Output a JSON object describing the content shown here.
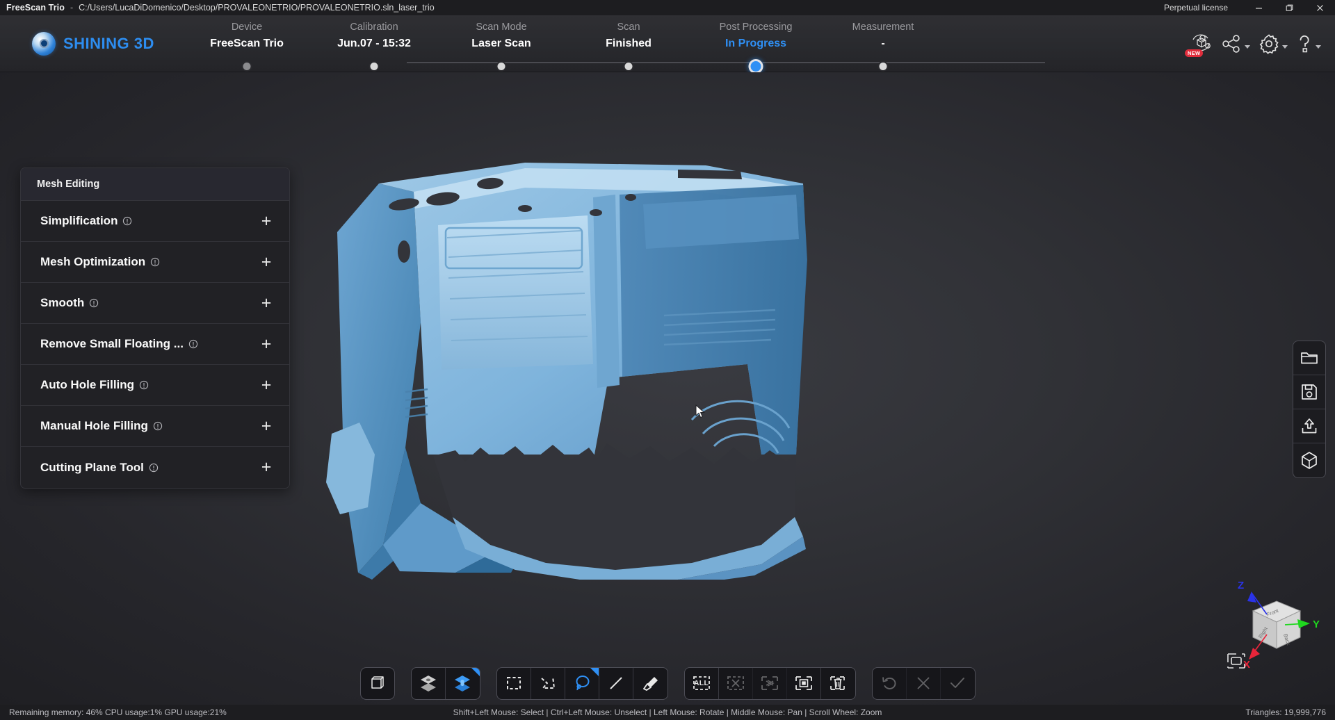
{
  "titlebar": {
    "app_name": "FreeScan Trio",
    "separator": "-",
    "file_path": "C:/Users/LucaDiDomenico/Desktop/PROVALEONETRIO/PROVALEONETRIO.sln_laser_trio",
    "license": "Perpetual license",
    "minimize_label": "minimize-icon",
    "restore_label": "restore-icon",
    "close_label": "close-icon"
  },
  "brand": {
    "name": "SHINING 3D"
  },
  "steps": [
    {
      "label": "Device",
      "value": "FreeScan Trio",
      "state": "filled"
    },
    {
      "label": "Calibration",
      "value": "Jun.07 - 15:32",
      "state": "done"
    },
    {
      "label": "Scan Mode",
      "value": "Laser Scan",
      "state": "done"
    },
    {
      "label": "Scan",
      "value": "Finished",
      "state": "done"
    },
    {
      "label": "Post Processing",
      "value": "In Progress",
      "state": "active"
    },
    {
      "label": "Measurement",
      "value": "-",
      "state": "done"
    }
  ],
  "header_icons": [
    {
      "name": "new-model-icon",
      "badge": "NEW",
      "caret": false
    },
    {
      "name": "share-icon",
      "badge": "",
      "caret": true
    },
    {
      "name": "settings-icon",
      "badge": "",
      "caret": true
    },
    {
      "name": "help-icon",
      "badge": "",
      "caret": true
    }
  ],
  "panel": {
    "title": "Mesh Editing",
    "expand_symbol": "+",
    "rows": [
      {
        "label": "Simplification"
      },
      {
        "label": "Mesh Optimization"
      },
      {
        "label": "Smooth"
      },
      {
        "label": "Remove Small Floating ..."
      },
      {
        "label": "Auto Hole Filling"
      },
      {
        "label": "Manual Hole Filling"
      },
      {
        "label": "Cutting Plane Tool"
      }
    ]
  },
  "right_rail": [
    {
      "name": "open-folder-icon"
    },
    {
      "name": "save-icon"
    },
    {
      "name": "export-icon"
    },
    {
      "name": "model-view-icon"
    }
  ],
  "gizmo": {
    "axis_x": "X",
    "axis_y": "Y",
    "axis_z": "Z",
    "face_front": "Front",
    "face_back": "Back",
    "face_right": "Right",
    "fit_icon": "fit-to-view-icon",
    "color_x": "#e8253a",
    "color_y": "#1fd81f",
    "color_z": "#2a33e8"
  },
  "toolbar": {
    "groups": [
      {
        "buttons": [
          {
            "name": "bounding-box-icon",
            "state": "normal",
            "badge": false
          }
        ]
      },
      {
        "buttons": [
          {
            "name": "layers-single-icon",
            "state": "normal",
            "badge": false
          },
          {
            "name": "layers-both-sides-icon",
            "state": "active",
            "badge": true
          }
        ]
      },
      {
        "buttons": [
          {
            "name": "rectangle-select-icon",
            "state": "normal",
            "badge": false
          },
          {
            "name": "polygon-select-icon",
            "state": "normal",
            "badge": false
          },
          {
            "name": "lasso-select-icon",
            "state": "active",
            "badge": true
          },
          {
            "name": "line-select-icon",
            "state": "normal",
            "badge": false
          },
          {
            "name": "brush-select-icon",
            "state": "normal",
            "badge": false
          }
        ]
      },
      {
        "buttons": [
          {
            "name": "select-all-icon",
            "state": "normal",
            "badge": false,
            "label": "ALL"
          },
          {
            "name": "deselect-all-icon",
            "state": "disabled",
            "badge": false
          },
          {
            "name": "invert-selection-icon",
            "state": "disabled",
            "badge": false
          },
          {
            "name": "select-visible-icon",
            "state": "normal",
            "badge": false
          },
          {
            "name": "delete-selection-icon",
            "state": "normal",
            "badge": false
          }
        ]
      },
      {
        "buttons": [
          {
            "name": "undo-icon",
            "state": "disabled",
            "badge": false
          },
          {
            "name": "cancel-icon",
            "state": "disabled",
            "badge": false
          },
          {
            "name": "confirm-icon",
            "state": "disabled",
            "badge": false
          }
        ]
      }
    ]
  },
  "status": {
    "resources": "Remaining memory: 46% CPU usage:1%  GPU usage:21%",
    "mouse_hints": "Shift+Left Mouse: Select | Ctrl+Left Mouse: Unselect | Left Mouse: Rotate | Middle Mouse: Pan | Scroll Wheel: Zoom",
    "triangles": "Triangles: 19,999,776"
  }
}
